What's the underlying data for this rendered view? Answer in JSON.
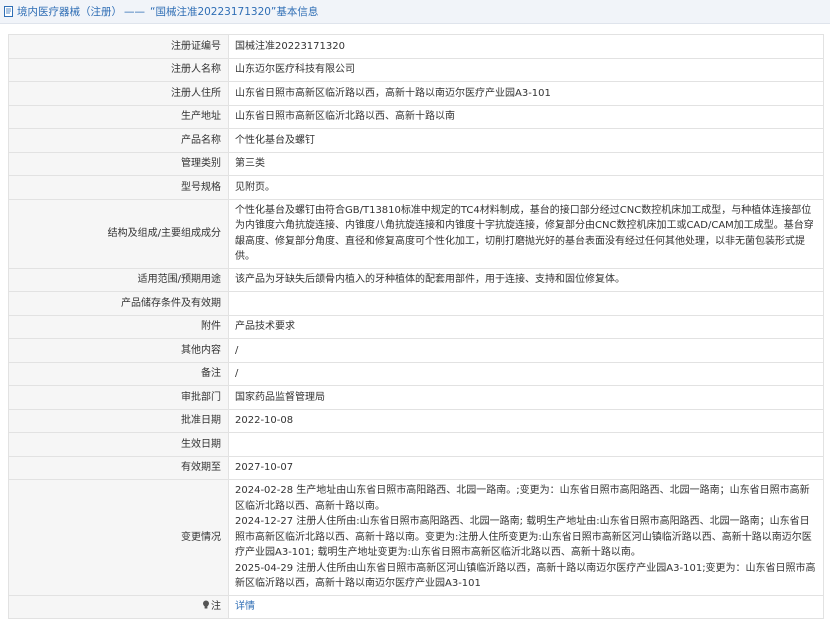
{
  "header": {
    "breadcrumb": "境内医疗器械（注册）",
    "separator": "——",
    "title": "“国械注准20223171320”基本信息"
  },
  "rows": [
    {
      "label": "注册证编号",
      "value": "国械注准20223171320"
    },
    {
      "label": "注册人名称",
      "value": "山东迈尔医疗科技有限公司"
    },
    {
      "label": "注册人住所",
      "value": "山东省日照市高新区临沂路以西，高新十路以南迈尔医疗产业园A3-101"
    },
    {
      "label": "生产地址",
      "value": "山东省日照市高新区临沂北路以西、高新十路以南"
    },
    {
      "label": "产品名称",
      "value": "个性化基台及螺钉"
    },
    {
      "label": "管理类别",
      "value": "第三类"
    },
    {
      "label": "型号规格",
      "value": "见附页。"
    },
    {
      "label": "结构及组成/主要组成成分",
      "value": "个性化基台及螺钉由符合GB/T13810标准中规定的TC4材料制成，基台的接口部分经过CNC数控机床加工成型，与种植体连接部位为内锥度六角抗旋连接、内锥度八角抗旋连接和内锥度十字抗旋连接，修复部分由CNC数控机床加工或CAD/CAM加工成型。基台穿龈高度、修复部分角度、直径和修复高度可个性化加工，切削打磨抛光好的基台表面没有经过任何其他处理，以非无菌包装形式提供。"
    },
    {
      "label": "适用范围/预期用途",
      "value": "该产品为牙缺失后颌骨内植入的牙种植体的配套用部件，用于连接、支持和固位修复体。"
    },
    {
      "label": "产品储存条件及有效期",
      "value": ""
    },
    {
      "label": "附件",
      "value": "产品技术要求"
    },
    {
      "label": "其他内容",
      "value": "/"
    },
    {
      "label": "备注",
      "value": "/"
    },
    {
      "label": "审批部门",
      "value": "国家药品监督管理局"
    },
    {
      "label": "批准日期",
      "value": "2022-10-08"
    },
    {
      "label": "生效日期",
      "value": ""
    },
    {
      "label": "有效期至",
      "value": "2027-10-07"
    }
  ],
  "changes": {
    "label": "变更情况",
    "lines": [
      "2024-02-28 生产地址由山东省日照市高阳路西、北园一路南。;变更为：山东省日照市高阳路西、北园一路南；山东省日照市高新区临沂北路以西、高新十路以南。",
      "2024-12-27 注册人住所由:山东省日照市高阳路西、北园一路南; 载明生产地址由:山东省日照市高阳路西、北园一路南；山东省日照市高新区临沂北路以西、高新十路以南。变更为:注册人住所变更为:山东省日照市高新区河山镇临沂路以西、高新十路以南迈尔医疗产业园A3-101; 载明生产地址变更为:山东省日照市高新区临沂北路以西、高新十路以南。",
      "2025-04-29 注册人住所由山东省日照市高新区河山镇临沂路以西，高新十路以南迈尔医疗产业园A3-101;变更为：山东省日照市高新区临沂路以西，高新十路以南迈尔医疗产业园A3-101"
    ]
  },
  "footer_row": {
    "label": "注",
    "link": "详情"
  },
  "colors": {
    "link": "#2f6eb5",
    "label_bg": "#f6f6f6",
    "border": "#e2e2e2",
    "header_bg": "#f1f4f9"
  },
  "icons": {
    "header": "document-icon",
    "footer": "lightbulb-icon"
  }
}
